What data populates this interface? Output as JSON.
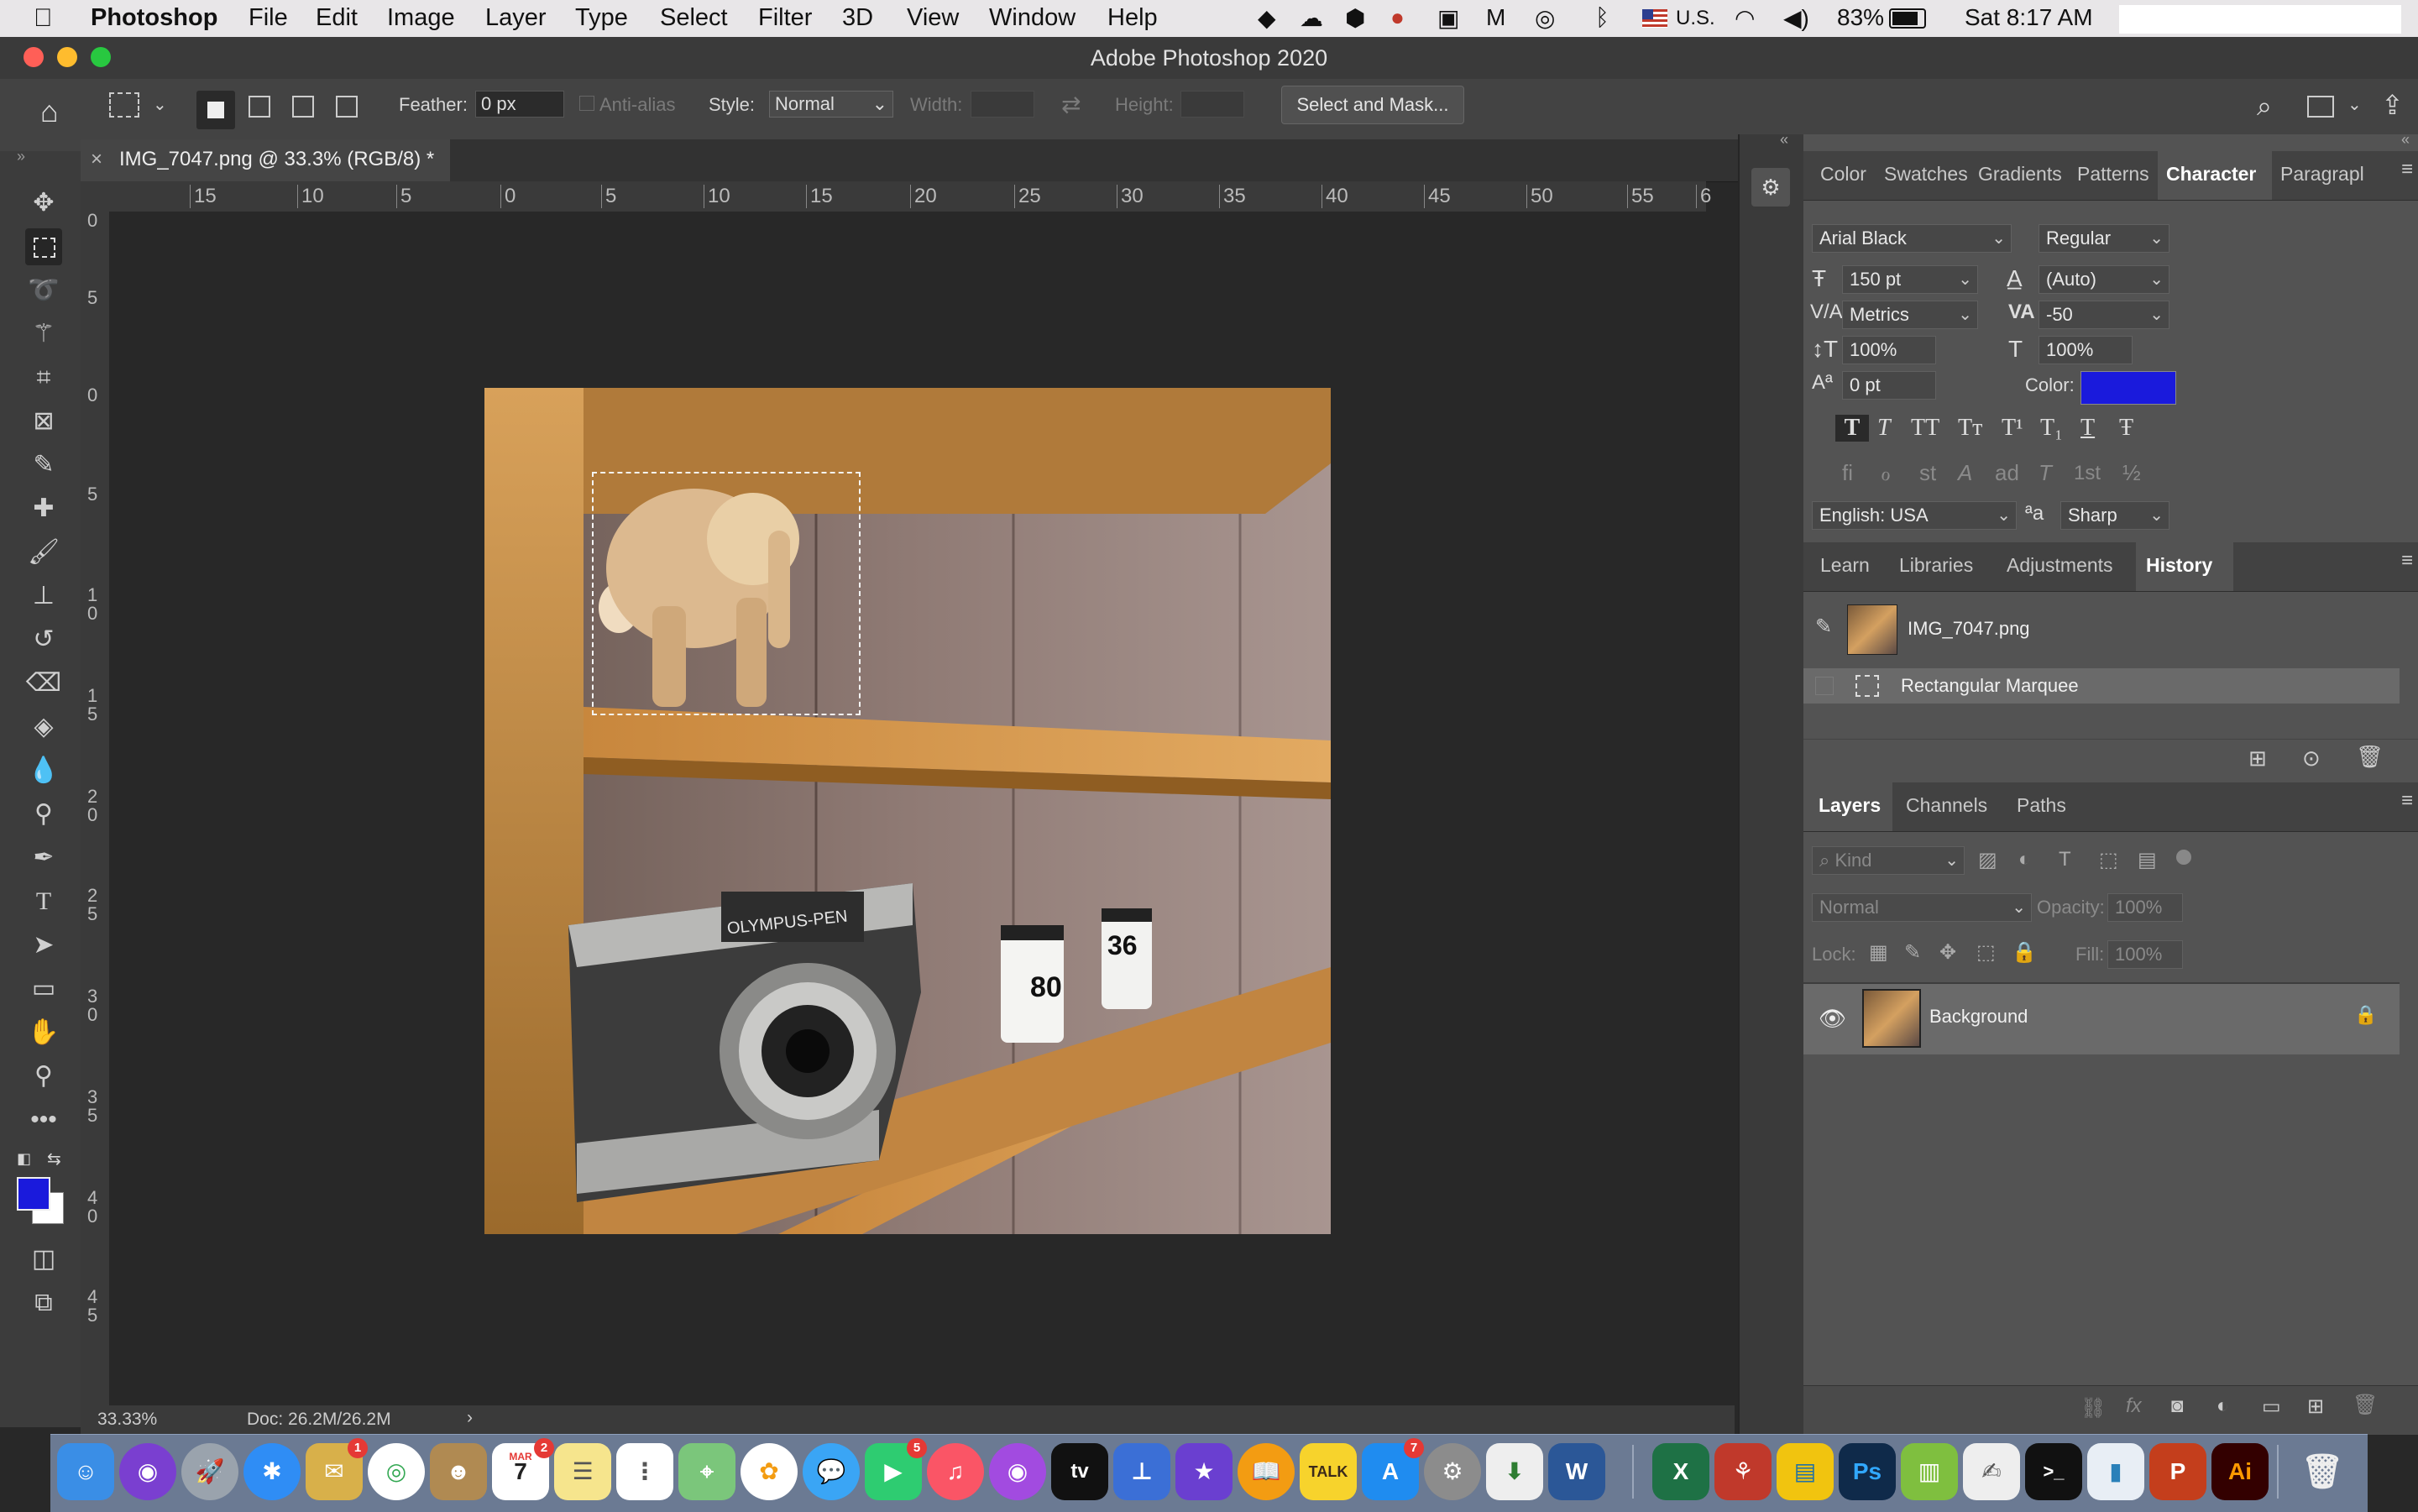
{
  "menubar": {
    "app_name": "Photoshop",
    "items": [
      "File",
      "Edit",
      "Image",
      "Layer",
      "Type",
      "Select",
      "Filter",
      "3D",
      "View",
      "Window",
      "Help"
    ],
    "input_source": "U.S.",
    "battery": "83%",
    "clock": "Sat 8:17 AM"
  },
  "window": {
    "title": "Adobe Photoshop 2020"
  },
  "options": {
    "feather_label": "Feather:",
    "feather_value": "0 px",
    "anti_alias_label": "Anti-alias",
    "style_label": "Style:",
    "style_value": "Normal",
    "width_label": "Width:",
    "height_label": "Height:",
    "select_mask": "Select and Mask..."
  },
  "document": {
    "tab_title": "IMG_7047.png @ 33.3% (RGB/8) *",
    "close_glyph": "×"
  },
  "rulers": {
    "h_labels": [
      "15",
      "10",
      "5",
      "0",
      "5",
      "10",
      "15",
      "20",
      "25",
      "30",
      "35",
      "40",
      "45",
      "50",
      "55",
      "6"
    ],
    "v_labels": [
      "0",
      "5",
      "0",
      "5",
      "1 0",
      "1 5",
      "2 0",
      "2 5",
      "3 0",
      "3 5",
      "4 0",
      "4 5"
    ]
  },
  "status": {
    "zoom": "33.33%",
    "doc": "Doc: 26.2M/26.2M",
    "arrow": "›"
  },
  "character": {
    "tabs": [
      "Color",
      "Swatches",
      "Gradients",
      "Patterns",
      "Character",
      "Paragrapl"
    ],
    "font_family": "Arial Black",
    "font_style": "Regular",
    "size": "150 pt",
    "leading": "(Auto)",
    "kerning": "Metrics",
    "tracking": "-50",
    "vscale": "100%",
    "hscale": "100%",
    "baseline": "0 pt",
    "color_label": "Color:",
    "color_hex": "#1a1adc",
    "language": "English: USA",
    "antialias": "Sharp",
    "aa_glyph": "ªa",
    "style_buttons": [
      "T",
      "T",
      "TT",
      "Tт",
      "T¹",
      "T₁",
      "T",
      "Ŧ"
    ],
    "opentype_buttons": [
      "fi",
      "ℴ",
      "st",
      "A",
      "ad",
      "T",
      "1st",
      "½"
    ]
  },
  "history": {
    "tabs": [
      "Learn",
      "Libraries",
      "Adjustments",
      "History"
    ],
    "snapshot": "IMG_7047.png",
    "items": [
      "Rectangular Marquee"
    ]
  },
  "layers": {
    "tabs": [
      "Layers",
      "Channels",
      "Paths"
    ],
    "filter_kind": "Kind",
    "blend_mode": "Normal",
    "opacity_label": "Opacity:",
    "opacity_value": "100%",
    "lock_label": "Lock:",
    "fill_label": "Fill:",
    "fill_value": "100%",
    "rows": [
      {
        "name": "Background",
        "visible": true,
        "locked": true
      }
    ]
  },
  "image": {
    "camera_brand": "OLYMPUS-PEN",
    "film_a": "36",
    "film_b": "80"
  },
  "dock": {
    "badges": {
      "mail": "1",
      "calendar": "2",
      "facetime": "5",
      "appstore": "7"
    },
    "calendar_month": "MAR",
    "calendar_day": "7",
    "appletv": "tv",
    "talk": "TALK",
    "word": "W",
    "excel": "X",
    "ps": "Ps",
    "ai": "Ai",
    "ppt": "P"
  }
}
